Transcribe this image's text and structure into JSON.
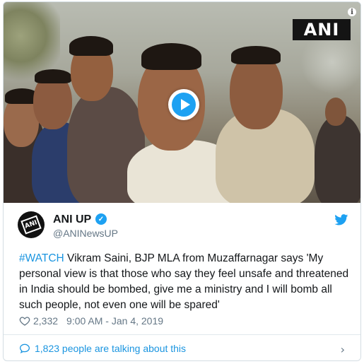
{
  "video": {
    "watermark": "ANI",
    "info_glyph": "i",
    "play_icon": "play-icon"
  },
  "author": {
    "name": "ANI UP",
    "handle": "@ANINewsUP",
    "verified_icon": "verified-badge-icon",
    "avatar_text": "ANI"
  },
  "tweet": {
    "hashtag": "#WATCH",
    "body": " Vikram Saini, BJP MLA from Muzaffarnagar says 'My personal view is that those who say they feel unsafe  and threatened in India should be bombed, give me a ministry and I will bomb all such people, not even one will be spared'"
  },
  "meta": {
    "likes": "2,332",
    "timestamp": "9:00 AM - Jan 4, 2019"
  },
  "footer": {
    "talking": "1,823 people are talking about this",
    "chevron": "›"
  },
  "colors": {
    "link": "#1b95e0",
    "twitter_blue": "#1da1f2",
    "secondary_text": "#657786"
  }
}
